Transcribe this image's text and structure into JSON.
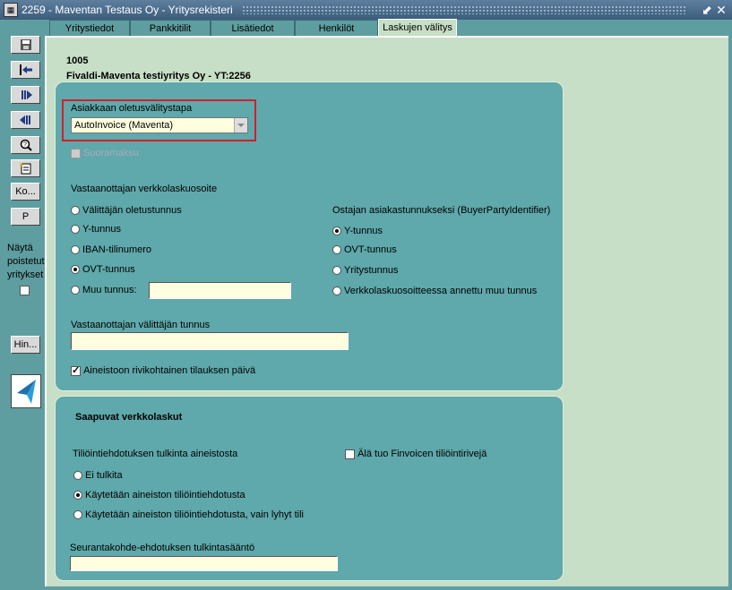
{
  "window": {
    "title": "2259 - Maventan Testaus Oy - Yritysrekisteri",
    "app_icon": "calculator-icon",
    "minimize_glyph": "⬋",
    "close_glyph": "✕"
  },
  "tabs": [
    {
      "label": "Yritystiedot"
    },
    {
      "label": "Pankkitilit"
    },
    {
      "label": "Lisätiedot"
    },
    {
      "label": "Henkilöt"
    },
    {
      "label": "Laskujen välitys"
    }
  ],
  "sidebar": {
    "buttons": {
      "save": "floppy-disk-icon",
      "exit": "exit-arrow-icon",
      "next": "next-record-icon",
      "previous": "previous-record-icon",
      "search": "magnifier-icon",
      "new": "new-document-icon",
      "ko_label": "Ko...",
      "p_label": "P",
      "hin_label": "Hin..."
    },
    "show_deleted": {
      "line1": "Näytä",
      "line2": "poistetut",
      "line3": "yritykset",
      "checked": false
    }
  },
  "header": {
    "company_number": "1005",
    "company_name": "Fivaldi-Maventa testiyritys Oy - YT:2256"
  },
  "panel1": {
    "default_method_label": "Asiakkaan oletusvälitystapa",
    "default_method_value": "AutoInvoice (Maventa)",
    "direct_payment_label": "Suoramaksu",
    "direct_payment_checked": false,
    "receiver_address_label": "Vastaanottajan verkkolaskuosoite",
    "receiver_options": [
      {
        "label": "Välittäjän oletustunnus",
        "selected": false
      },
      {
        "label": "Y-tunnus",
        "selected": false
      },
      {
        "label": "IBAN-tilinumero",
        "selected": false
      },
      {
        "label": "OVT-tunnus",
        "selected": true
      },
      {
        "label": "Muu tunnus:",
        "selected": false
      }
    ],
    "other_id_value": "",
    "buyer_id_label": "Ostajan asiakastunnukseksi (BuyerPartyIdentifier)",
    "buyer_options": [
      {
        "label": "Y-tunnus",
        "selected": true
      },
      {
        "label": "OVT-tunnus",
        "selected": false
      },
      {
        "label": "Yritystunnus",
        "selected": false
      },
      {
        "label": "Verkkolaskuosoitteessa annettu muu tunnus",
        "selected": false
      }
    ],
    "operator_id_label": "Vastaanottajan välittäjän tunnus",
    "operator_id_value": "",
    "row_order_date_label": "Aineistoon rivikohtainen tilauksen päivä",
    "row_order_date_checked": true
  },
  "panel2": {
    "title": "Saapuvat verkkolaskut",
    "interpretation_label": "Tiliöintiehdotuksen tulkinta aineistosta",
    "interpretation_options": [
      {
        "label": "Ei tulkita",
        "selected": false
      },
      {
        "label": "Käytetään aineiston tiliöintiehdotusta",
        "selected": true
      },
      {
        "label": "Käytetään aineiston tiliöintiehdotusta, vain lyhyt tili",
        "selected": false
      }
    ],
    "no_finvoice_label": "Älä tuo Finvoicen tiliöintirivejä",
    "no_finvoice_checked": false,
    "tracking_rule_label": "Seurantakohde-ehdotuksen tulkintasääntö",
    "tracking_rule_value": ""
  },
  "colors": {
    "accent_red": "#d0202a",
    "panel": "#5fa8ab",
    "content_bg": "#c6dfc6",
    "field_bg": "#ffffe0"
  }
}
